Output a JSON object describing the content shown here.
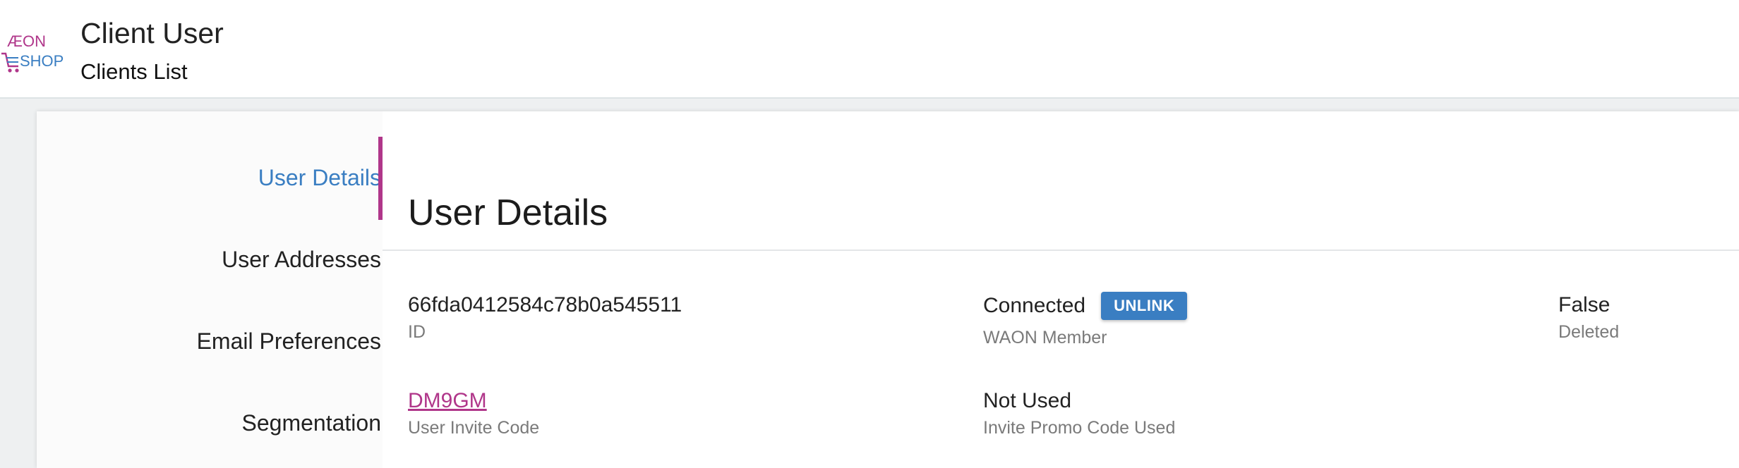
{
  "header": {
    "logo_top": "ÆON",
    "logo_bottom": "SHOP",
    "title": "Client User",
    "subtitle": "Clients List"
  },
  "sidebar": {
    "items": [
      {
        "label": "User Details",
        "active": true
      },
      {
        "label": "User Addresses",
        "active": false
      },
      {
        "label": "Email Preferences",
        "active": false
      },
      {
        "label": "Segmentation",
        "active": false
      }
    ]
  },
  "main": {
    "section_title": "User Details",
    "fields": {
      "id": {
        "value": "66fda0412584c78b0a545511",
        "label": "ID"
      },
      "waon": {
        "value": "Connected",
        "label": "WAON Member",
        "button": "UNLINK"
      },
      "deleted": {
        "value": "False",
        "label": "Deleted"
      },
      "invite_code": {
        "value": "DM9GM",
        "label": "User Invite Code"
      },
      "promo_used": {
        "value": "Not Used",
        "label": "Invite Promo Code Used"
      }
    }
  },
  "colors": {
    "accent_blue": "#3a7ec2",
    "accent_magenta": "#b0368a"
  }
}
